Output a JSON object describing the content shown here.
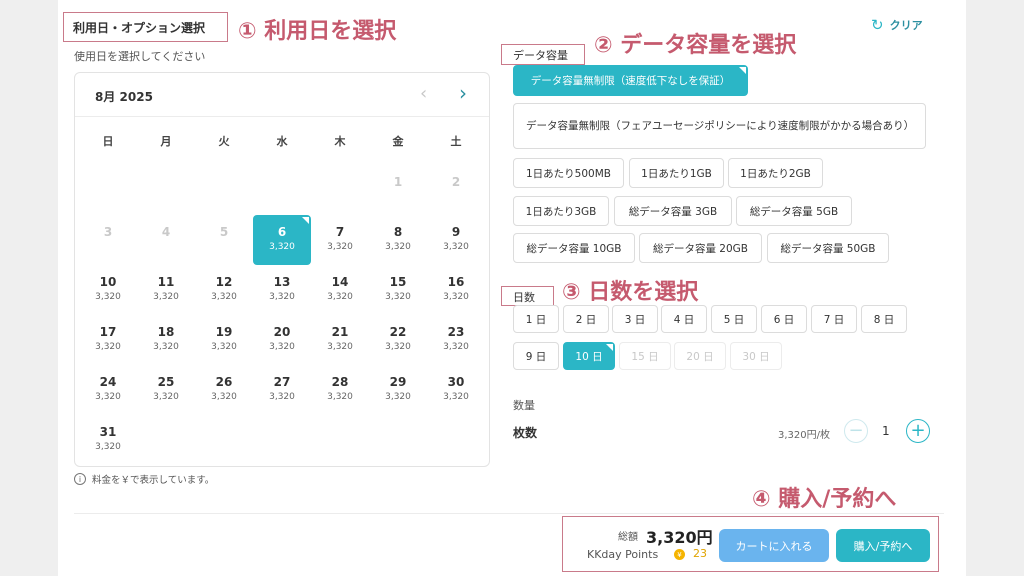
{
  "annotations": {
    "step1": "① 利用日を選択",
    "step2": "② データ容量を選択",
    "step3": "③ 日数を選択",
    "step4": "④ 購入/予約へ"
  },
  "section_title": "利用日・オプション選択",
  "date_prompt": "使用日を選択してください",
  "clear_label": "クリア",
  "calendar": {
    "month": "8月 2025",
    "weekdays": [
      "日",
      "月",
      "火",
      "水",
      "木",
      "金",
      "土"
    ],
    "days": [
      {
        "n": "1",
        "p": "",
        "state": "disabled"
      },
      {
        "n": "2",
        "p": "",
        "state": "disabled"
      },
      {
        "n": "3",
        "p": "",
        "state": "disabled"
      },
      {
        "n": "4",
        "p": "",
        "state": "disabled"
      },
      {
        "n": "5",
        "p": "",
        "state": "disabled"
      },
      {
        "n": "6",
        "p": "3,320",
        "state": "selected"
      },
      {
        "n": "7",
        "p": "3,320",
        "state": "normal"
      },
      {
        "n": "8",
        "p": "3,320",
        "state": "normal"
      },
      {
        "n": "9",
        "p": "3,320",
        "state": "normal"
      },
      {
        "n": "10",
        "p": "3,320",
        "state": "normal"
      },
      {
        "n": "11",
        "p": "3,320",
        "state": "normal"
      },
      {
        "n": "12",
        "p": "3,320",
        "state": "normal"
      },
      {
        "n": "13",
        "p": "3,320",
        "state": "normal"
      },
      {
        "n": "14",
        "p": "3,320",
        "state": "normal"
      },
      {
        "n": "15",
        "p": "3,320",
        "state": "normal"
      },
      {
        "n": "16",
        "p": "3,320",
        "state": "normal"
      },
      {
        "n": "17",
        "p": "3,320",
        "state": "normal"
      },
      {
        "n": "18",
        "p": "3,320",
        "state": "normal"
      },
      {
        "n": "19",
        "p": "3,320",
        "state": "normal"
      },
      {
        "n": "20",
        "p": "3,320",
        "state": "normal"
      },
      {
        "n": "21",
        "p": "3,320",
        "state": "normal"
      },
      {
        "n": "22",
        "p": "3,320",
        "state": "normal"
      },
      {
        "n": "23",
        "p": "3,320",
        "state": "normal"
      },
      {
        "n": "24",
        "p": "3,320",
        "state": "normal"
      },
      {
        "n": "25",
        "p": "3,320",
        "state": "normal"
      },
      {
        "n": "26",
        "p": "3,320",
        "state": "normal"
      },
      {
        "n": "27",
        "p": "3,320",
        "state": "normal"
      },
      {
        "n": "28",
        "p": "3,320",
        "state": "normal"
      },
      {
        "n": "29",
        "p": "3,320",
        "state": "normal"
      },
      {
        "n": "30",
        "p": "3,320",
        "state": "normal"
      },
      {
        "n": "31",
        "p": "3,320",
        "state": "normal"
      }
    ],
    "first_weekday_index": 5
  },
  "price_note": "料金を￥で表示しています。",
  "data_capacity": {
    "label": "データ容量",
    "options": [
      {
        "label": "データ容量無制限（速度低下なしを保証）",
        "state": "selected"
      },
      {
        "label": "データ容量無制限（フェアユーセージポリシーにより速度制限がかかる場合あり）",
        "state": "normal"
      },
      {
        "label": "1日あたり500MB",
        "state": "normal"
      },
      {
        "label": "1日あたり1GB",
        "state": "normal"
      },
      {
        "label": "1日あたり2GB",
        "state": "normal"
      },
      {
        "label": "1日あたり3GB",
        "state": "normal"
      },
      {
        "label": "総データ容量 3GB",
        "state": "normal"
      },
      {
        "label": "総データ容量 5GB",
        "state": "normal"
      },
      {
        "label": "総データ容量 10GB",
        "state": "normal"
      },
      {
        "label": "総データ容量 20GB",
        "state": "normal"
      },
      {
        "label": "総データ容量 50GB",
        "state": "normal"
      }
    ]
  },
  "days_option": {
    "label": "日数",
    "options": [
      {
        "label": "1 日",
        "state": "normal"
      },
      {
        "label": "2 日",
        "state": "normal"
      },
      {
        "label": "3 日",
        "state": "normal"
      },
      {
        "label": "4 日",
        "state": "normal"
      },
      {
        "label": "5 日",
        "state": "normal"
      },
      {
        "label": "6 日",
        "state": "normal"
      },
      {
        "label": "7 日",
        "state": "normal"
      },
      {
        "label": "8 日",
        "state": "normal"
      },
      {
        "label": "9 日",
        "state": "normal"
      },
      {
        "label": "10 日",
        "state": "selected"
      },
      {
        "label": "15 日",
        "state": "disabled"
      },
      {
        "label": "20 日",
        "state": "disabled"
      },
      {
        "label": "30 日",
        "state": "disabled"
      }
    ]
  },
  "quantity": {
    "section_label": "数量",
    "item_label": "枚数",
    "unit_price": "3,320円/枚",
    "value": "1",
    "minus": "−",
    "plus": "+"
  },
  "summary": {
    "total_label": "総額",
    "total_value": "3,320円",
    "points_label": "KKday Points",
    "points_value": "23",
    "points_icon": "coin-icon"
  },
  "buttons": {
    "cart": "カートに入れる",
    "buy": "購入/予約へ"
  },
  "colors": {
    "accent": "#2bb6c6",
    "annotation": "#c55a6e",
    "cart_button": "#6ab4ee",
    "points_coin": "#f5b400"
  }
}
